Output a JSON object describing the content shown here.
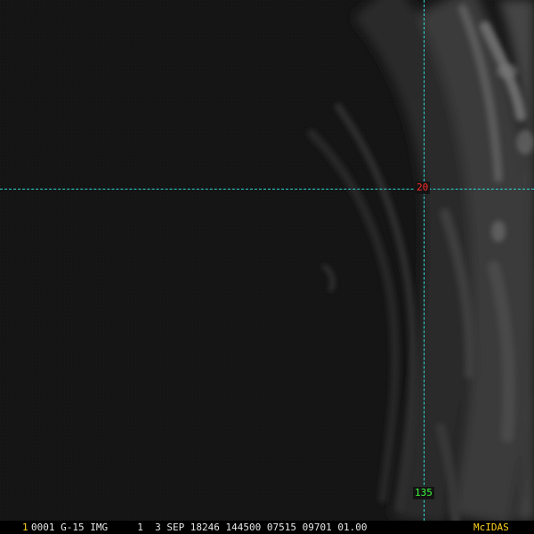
{
  "overlay": {
    "latitude_label": "20",
    "longitude_label": "135"
  },
  "status_bar": {
    "frame_number": "1",
    "info_text": "0001 G-15 IMG     1  3 SEP 18246 144500 07515 09701 01.00",
    "brand": "McIDAS"
  },
  "colors": {
    "latitude_label": "#ff2a2a",
    "longitude_label": "#3cff3c",
    "grid_lines": "#2fd6d6",
    "brand": "#ffd21f",
    "background": "#141414"
  }
}
